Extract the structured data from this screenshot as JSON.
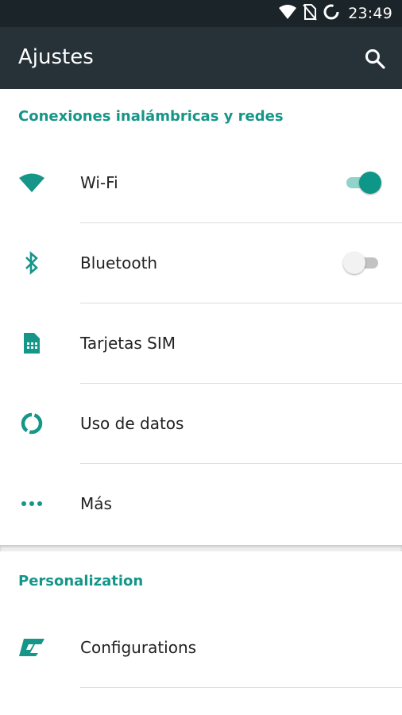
{
  "status_bar": {
    "time": "23:49",
    "icons": [
      "wifi-icon",
      "no-sim-icon",
      "loading-circle-icon"
    ]
  },
  "app_bar": {
    "title": "Ajustes",
    "search_icon": "search-icon"
  },
  "sections": [
    {
      "header": "Conexiones inalámbricas y redes",
      "items": [
        {
          "label": "Wi-Fi",
          "icon": "wifi-icon",
          "toggle": "on"
        },
        {
          "label": "Bluetooth",
          "icon": "bluetooth-icon",
          "toggle": "off"
        },
        {
          "label": "Tarjetas SIM",
          "icon": "sim-card-icon"
        },
        {
          "label": "Uso de datos",
          "icon": "data-usage-icon"
        },
        {
          "label": "Más",
          "icon": "more-dots-icon"
        }
      ]
    },
    {
      "header": "Personalization",
      "items": [
        {
          "label": "Configurations",
          "icon": "configurations-icon"
        }
      ]
    }
  ],
  "colors": {
    "accent": "#159688",
    "app_bar": "#263238",
    "status_bar": "#1b2428"
  }
}
